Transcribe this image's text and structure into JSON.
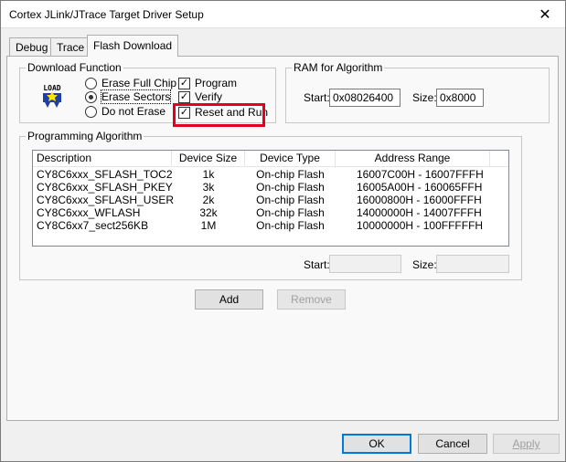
{
  "window": {
    "title": "Cortex JLink/JTrace Target Driver Setup",
    "close_glyph": "✕"
  },
  "tabs": [
    {
      "label": "Debug",
      "active": false
    },
    {
      "label": "Trace",
      "active": false
    },
    {
      "label": "Flash Download",
      "active": true
    }
  ],
  "download_function": {
    "legend": "Download Function",
    "icon_text": "LOAD",
    "radios": [
      {
        "label": "Erase Full Chip",
        "selected": false
      },
      {
        "label": "Erase Sectors",
        "selected": true
      },
      {
        "label": "Do not Erase",
        "selected": false
      }
    ],
    "checks": [
      {
        "label": "Program",
        "checked": true
      },
      {
        "label": "Verify",
        "checked": true
      },
      {
        "label": "Reset and Run",
        "checked": true
      }
    ],
    "check_glyph": "✓"
  },
  "ram_for_algorithm": {
    "legend": "RAM for Algorithm",
    "start_label": "Start:",
    "start_value": "0x08026400",
    "size_label": "Size:",
    "size_value": "0x8000"
  },
  "programming_algorithm": {
    "legend": "Programming Algorithm",
    "columns": [
      "Description",
      "Device Size",
      "Device Type",
      "Address Range"
    ],
    "rows": [
      [
        "CY8C6xxx_SFLASH_TOC2",
        "1k",
        "On-chip Flash",
        "16007C00H - 16007FFFH"
      ],
      [
        "CY8C6xxx_SFLASH_PKEY",
        "3k",
        "On-chip Flash",
        "16005A00H - 160065FFH"
      ],
      [
        "CY8C6xxx_SFLASH_USER",
        "2k",
        "On-chip Flash",
        "16000800H - 16000FFFH"
      ],
      [
        "CY8C6xxx_WFLASH",
        "32k",
        "On-chip Flash",
        "14000000H - 14007FFFH"
      ],
      [
        "CY8C6xx7_sect256KB",
        "1M",
        "On-chip Flash",
        "10000000H - 100FFFFFH"
      ]
    ],
    "start_label": "Start:",
    "start_value": "",
    "size_label": "Size:",
    "size_value": "",
    "add_label": "Add",
    "remove_label": "Remove"
  },
  "footer": {
    "ok_label": "OK",
    "cancel_label": "Cancel",
    "apply_label": "Apply"
  },
  "colors": {
    "highlight": "#e3001b",
    "focus_border": "#0078d7"
  }
}
